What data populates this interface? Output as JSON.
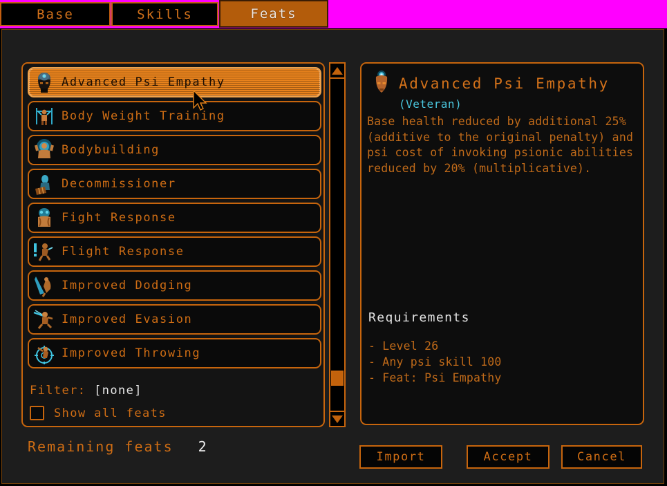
{
  "window": {
    "title": "Feats"
  },
  "tabs": [
    {
      "label": "Base",
      "active": false
    },
    {
      "label": "Skills",
      "active": false
    },
    {
      "label": "Feats",
      "active": true
    }
  ],
  "feat_list": {
    "items": [
      {
        "label": "Advanced Psi Empathy",
        "icon": "psi-head-icon",
        "selected": true
      },
      {
        "label": "Body Weight Training",
        "icon": "body-weight-icon",
        "selected": false
      },
      {
        "label": "Bodybuilding",
        "icon": "bodybuilding-icon",
        "selected": false
      },
      {
        "label": "Decommissioner",
        "icon": "decommissioner-icon",
        "selected": false
      },
      {
        "label": "Fight Response",
        "icon": "fight-response-icon",
        "selected": false
      },
      {
        "label": "Flight Response",
        "icon": "flight-response-icon",
        "selected": false
      },
      {
        "label": "Improved Dodging",
        "icon": "dodging-icon",
        "selected": false
      },
      {
        "label": "Improved Evasion",
        "icon": "evasion-icon",
        "selected": false
      },
      {
        "label": "Improved Throwing",
        "icon": "throwing-icon",
        "selected": false
      }
    ],
    "filter_label": "Filter:",
    "filter_value": "[none]",
    "show_all_label": "Show all feats",
    "show_all_checked": false
  },
  "scrollbar": {
    "up_icon": "triangle-up-icon",
    "down_icon": "triangle-down-icon",
    "thumb_position_percent": 88
  },
  "detail": {
    "icon": "psi-head-icon",
    "title": "Advanced Psi Empathy",
    "subtitle": "(Veteran)",
    "description": "Base health reduced by additional 25% (additive to the original penalty) and psi cost of invoking psionic abilities reduced by 20% (multiplicative).",
    "requirements_header": "Requirements",
    "requirements": [
      "- Level 26",
      "- Any psi skill 100",
      "- Feat: Psi Empathy"
    ]
  },
  "footer": {
    "remaining_label": "Remaining feats",
    "remaining_count": "2",
    "import_label": "Import",
    "accept_label": "Accept",
    "cancel_label": "Cancel"
  },
  "colors": {
    "accent_orange": "#c7650d",
    "text_orange": "#cf6d14",
    "highlight_orange": "#e8821c",
    "cyan": "#4bc8e0",
    "white_text": "#e9e9e9",
    "chroma_key": "#ff00ff",
    "panel_bg": "#141414"
  }
}
